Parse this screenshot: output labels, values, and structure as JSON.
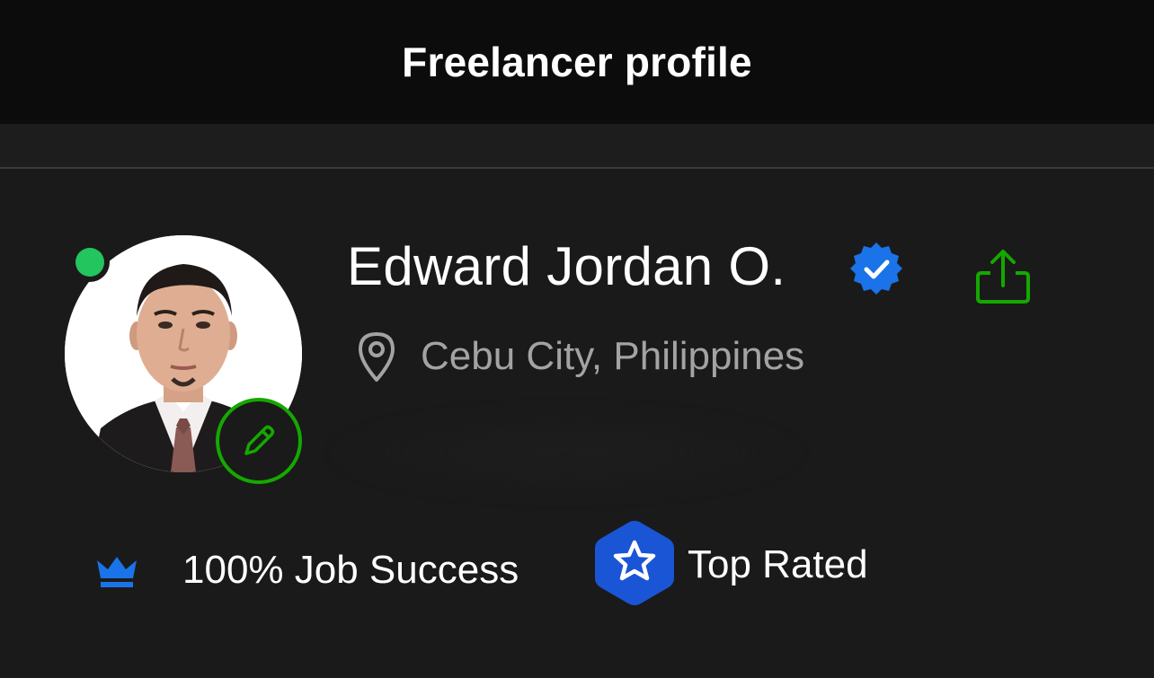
{
  "header": {
    "title": "Freelancer profile"
  },
  "profile": {
    "name": "Edward Jordan O.",
    "location": "Cebu City, Philippines",
    "online": true,
    "verified": true
  },
  "badges": {
    "job_success": "100% Job Success",
    "top_rated": "Top Rated"
  },
  "icons": {
    "edit": "pencil-icon",
    "share": "share-icon",
    "location": "location-pin-icon",
    "verified": "verified-badge-icon",
    "job_success": "crown-icon",
    "top_rated": "top-rated-badge-icon"
  },
  "colors": {
    "background": "#1a1a1a",
    "header_background": "#0c0c0c",
    "accent_green": "#14a800",
    "online_green": "#22c55e",
    "badge_blue": "#1a73e8",
    "secondary_text": "#a3a3a3"
  }
}
